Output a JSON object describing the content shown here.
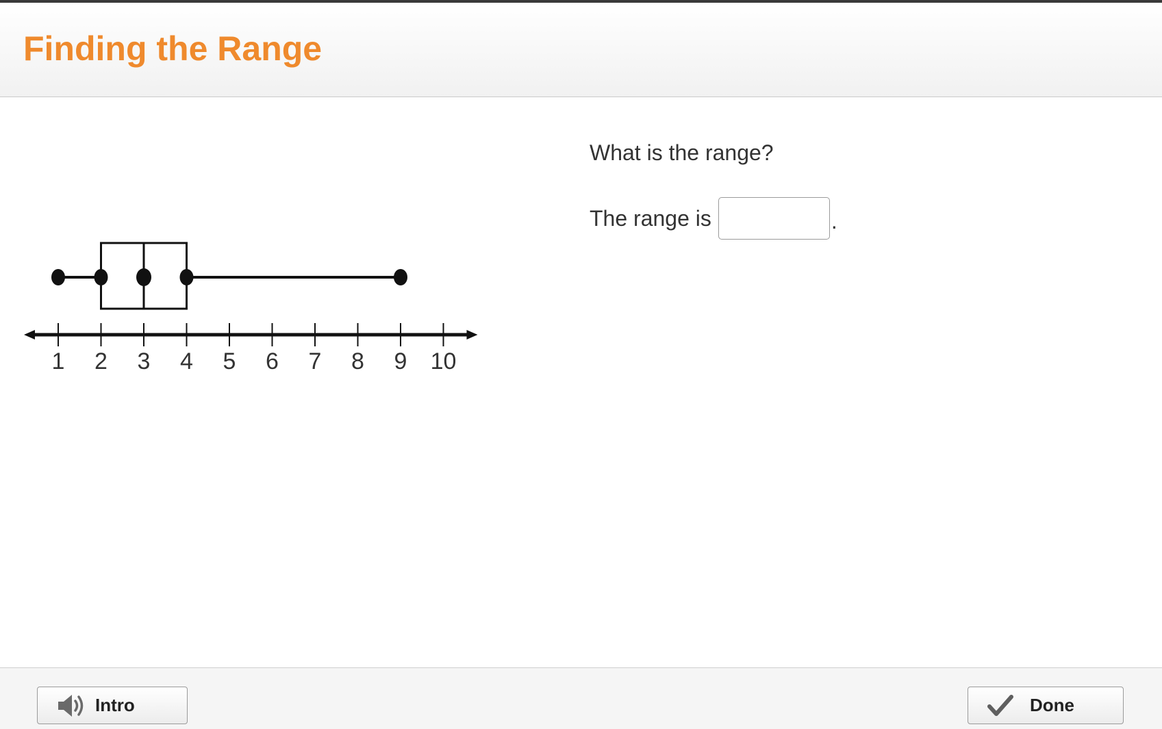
{
  "header": {
    "title": "Finding the Range"
  },
  "chart_data": {
    "type": "boxplot",
    "min": 1,
    "q1": 2,
    "median": 3,
    "q3": 4,
    "max": 9,
    "ticks": [
      1,
      2,
      3,
      4,
      5,
      6,
      7,
      8,
      9,
      10
    ],
    "xlim": [
      0.2,
      10.8
    ],
    "title": "",
    "xlabel": "",
    "ylabel": ""
  },
  "question": {
    "prompt": "What is the range?",
    "answer_label": "The range is",
    "answer_value": "",
    "answer_suffix": "."
  },
  "footer": {
    "intro_label": "Intro",
    "done_label": "Done",
    "intro_icon": "speaker-icon",
    "done_icon": "checkmark-icon"
  },
  "colors": {
    "title": "#ef8a2d",
    "plot": "#111111"
  }
}
